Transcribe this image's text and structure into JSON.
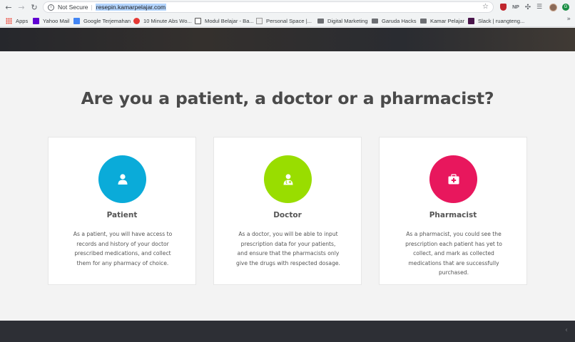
{
  "browser": {
    "security_label": "Not Secure",
    "url": "resepin.kamarpelajar.com",
    "extensions": {
      "np_label": "NP"
    },
    "bookmarks": [
      {
        "label": "Apps",
        "icon": "apps-grid-icon"
      },
      {
        "label": "Yahoo Mail",
        "icon": "yahoo-icon"
      },
      {
        "label": "Google Terjemahan",
        "icon": "google-translate-icon"
      },
      {
        "label": "10 Minute Abs Wo...",
        "icon": "youtube-icon"
      },
      {
        "label": "Modul Belajar - Ba...",
        "icon": "page-icon"
      },
      {
        "label": "Personal Space |...",
        "icon": "page-icon"
      },
      {
        "label": "Digital Marketing",
        "icon": "folder-icon"
      },
      {
        "label": "Garuda Hacks",
        "icon": "folder-icon"
      },
      {
        "label": "Kamar Pelajar",
        "icon": "folder-icon"
      },
      {
        "label": "Slack | ruangteng...",
        "icon": "slack-icon"
      }
    ]
  },
  "page": {
    "heading": "Are you a patient, a doctor or a pharmacist?",
    "cards": [
      {
        "title": "Patient",
        "icon": "user-icon",
        "color": "#0aabd9",
        "description": "As a patient, you will have access to records and history of your doctor prescribed medications, and collect them for any pharmacy of choice."
      },
      {
        "title": "Doctor",
        "icon": "doctor-icon",
        "color": "#99dd00",
        "description": "As a doctor, you will be able to input prescription data for your patients, and ensure that the pharmacists only give the drugs with respected dosage."
      },
      {
        "title": "Pharmacist",
        "icon": "medkit-icon",
        "color": "#e8175d",
        "description": "As a pharmacist, you could see the prescription each patient has yet to collect, and mark as collected medications that are successfully purchased."
      }
    ]
  }
}
